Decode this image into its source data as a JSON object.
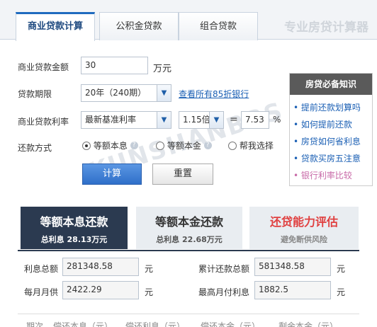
{
  "tabs": [
    {
      "label": "商业贷款计算",
      "active": true
    },
    {
      "label": "公积金贷款",
      "active": false
    },
    {
      "label": "组合贷款",
      "active": false
    }
  ],
  "brand": "专业房贷计算器",
  "form": {
    "amount_label": "商业贷款金额",
    "amount_value": "30",
    "amount_unit": "万元",
    "term_label": "贷款期限",
    "term_value": "20年（240期）",
    "banks_link": "查看所有85折银行",
    "rate_label": "商业贷款利率",
    "rate_type_value": "最新基准利率",
    "multiplier_value": "1.15倍",
    "equals": "=",
    "rate_value": "7.53",
    "percent": "%",
    "method_label": "还款方式",
    "method_options": [
      "等额本息",
      "等额本金",
      "帮我选择"
    ],
    "calc_button": "计算",
    "reset_button": "重置"
  },
  "knowledge": {
    "title": "房贷必备知识",
    "items": [
      "提前还款划算吗",
      "如何提前还款",
      "房贷如何省利息",
      "贷款买房五注意",
      "银行利率比较"
    ]
  },
  "panels": [
    {
      "title": "等额本息还款",
      "subtitle": "总利息 28.13万元",
      "active": true
    },
    {
      "title": "等额本金还款",
      "subtitle": "总利息 22.68万元",
      "active": false
    },
    {
      "title": "还贷能力评估",
      "subtitle": "避免断供风险",
      "active": false
    }
  ],
  "results": {
    "total_interest_label": "利息总额",
    "total_interest_value": "281348.58",
    "total_repay_label": "累计还款总额",
    "total_repay_value": "581348.58",
    "monthly_label": "每月月供",
    "monthly_value": "2422.29",
    "max_interest_label": "最高月付利息",
    "max_interest_value": "1882.5",
    "unit": "元"
  },
  "table_header": [
    "期次",
    "偿还本息（元）",
    "偿还利息（元）",
    "偿还本金（元）",
    "剩余本金（元）"
  ],
  "watermark": "KUNSHANBBS",
  "colors": {
    "accent": "#2f6fc9",
    "dark_panel": "#2b3a50",
    "risk_red": "#e04040"
  }
}
